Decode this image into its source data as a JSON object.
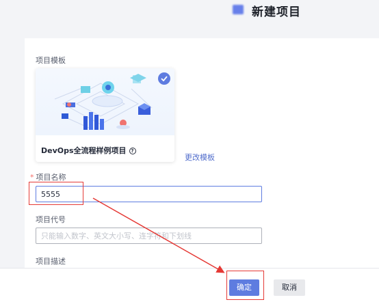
{
  "page": {
    "title": "新建项目"
  },
  "form": {
    "template_label": "项目模板",
    "template": {
      "name": "DevOps全流程样例项目",
      "help_icon": "help-circle-icon",
      "selected_icon": "check-icon"
    },
    "change_template_link": "更改模板",
    "name_label": "项目名称",
    "name_required_mark": "*",
    "name_value": "5555",
    "code_label": "项目代号",
    "code_placeholder": "只能输入数字、英文大小写、连字符和下划线",
    "desc_label": "项目描述"
  },
  "footer": {
    "confirm_label": "确定",
    "cancel_label": "取消"
  },
  "colors": {
    "accent": "#5e7ce0",
    "annotation": "#e53935",
    "link": "#526ecc"
  }
}
